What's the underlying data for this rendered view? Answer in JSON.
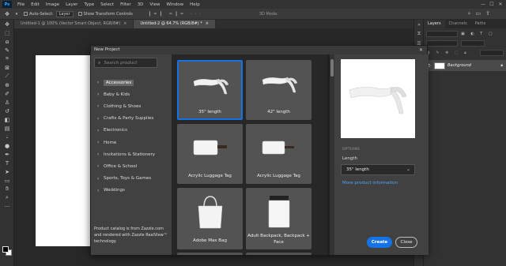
{
  "menubar": {
    "logo": "Ps",
    "items": [
      "File",
      "Edit",
      "Image",
      "Layer",
      "Type",
      "Select",
      "Filter",
      "3D",
      "View",
      "Window",
      "Help"
    ],
    "window_controls": [
      "—",
      "☐",
      "✕"
    ]
  },
  "optionsbar": {
    "auto_select_label": "Auto-Select:",
    "auto_select_value": "Layer",
    "transform_label": "Show Transform Controls",
    "mode_3d_label": "3D Mode:"
  },
  "tabs": [
    {
      "label": "Untitled-1 @ 100% (Vector Smart Object, RGB/8#)",
      "active": false
    },
    {
      "label": "Untitled-2 @ 64.7% (RGB/8#) *",
      "active": true
    }
  ],
  "toolbar": {
    "icons": [
      "move-icon",
      "marquee-icon",
      "lasso-icon",
      "quick-select-icon",
      "crop-icon",
      "frame-icon",
      "eyedropper-icon",
      "healing-icon",
      "brush-icon",
      "stamp-icon",
      "history-brush-icon",
      "eraser-icon",
      "gradient-icon",
      "blur-icon",
      "dodge-icon",
      "pen-icon",
      "type-icon",
      "path-select-icon",
      "rectangle-icon",
      "hand-icon",
      "zoom-icon",
      "more-icon"
    ]
  },
  "layers_panel": {
    "tabs": [
      "Layers",
      "Channels",
      "Paths"
    ],
    "filter_label": "Kind",
    "blend_mode": "Normal",
    "opacity_label": "Opacity:",
    "fill_label": "Fill:",
    "lock_label": "Lock:",
    "layer_name": "Background"
  },
  "dialog": {
    "title": "New Project",
    "close_glyph": "✕",
    "search_placeholder": "Search product",
    "categories": [
      {
        "label": "Accessories",
        "active": true
      },
      {
        "label": "Baby & Kids",
        "active": false
      },
      {
        "label": "Clothing & Shoes",
        "active": false
      },
      {
        "label": "Crafts & Party Supplies",
        "active": false
      },
      {
        "label": "Electronics",
        "active": false
      },
      {
        "label": "Home",
        "active": false
      },
      {
        "label": "Invitations & Stationery",
        "active": false
      },
      {
        "label": "Office & School",
        "active": false
      },
      {
        "label": "Sports, Toys & Games",
        "active": false
      },
      {
        "label": "Weddings",
        "active": false
      }
    ],
    "catalog_note": "Product catalog is from Zazzle.com and rendered with Zazzle RealView™ technology.",
    "products": [
      {
        "label": "35\" length",
        "icon": "headband-icon",
        "selected": true
      },
      {
        "label": "42\" length",
        "icon": "headband-icon",
        "selected": false
      },
      {
        "label": "Acrylic Luggage Tag",
        "icon": "luggage-tag-icon",
        "selected": false
      },
      {
        "label": "Acrylic Luggage Tag",
        "icon": "luggage-tag-icon",
        "selected": false
      },
      {
        "label": "Adobe Max Bag",
        "icon": "tote-bag-icon",
        "selected": false
      },
      {
        "label": "Adult Backpack, Backpack + Face",
        "icon": "backpack-icon",
        "selected": false
      }
    ],
    "options_heading": "OPTIONS",
    "length_label": "Length",
    "length_value": "35\" length",
    "more_info": "More product information",
    "create_button": "Create",
    "close_button": "Close"
  }
}
